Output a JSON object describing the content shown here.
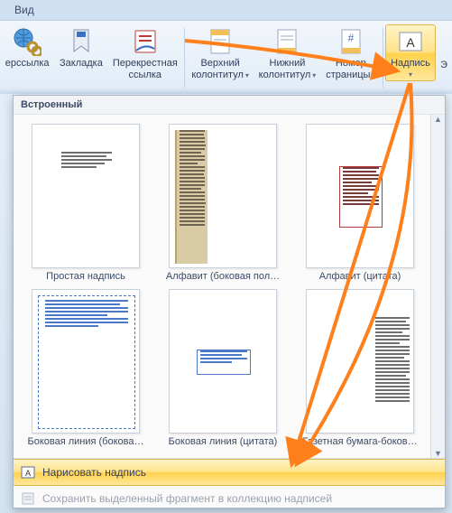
{
  "tab": {
    "label": "Вид"
  },
  "ribbon": {
    "hyperlink": "ерссылка",
    "bookmark": "Закладка",
    "crossref_l1": "Перекрестная",
    "crossref_l2": "ссылка",
    "header_l1": "Верхний",
    "header_l2": "колонтитул",
    "footer_l1": "Нижний",
    "footer_l2": "колонтитул",
    "pagenum_l1": "Номер",
    "pagenum_l2": "страницы",
    "textbox": "Надпись",
    "extra": "Э"
  },
  "panel": {
    "heading": "Встроенный",
    "items": [
      "Простая надпись",
      "Алфавит (боковая пол…",
      "Алфавит (цитата)",
      "Боковая линия (бокова…",
      "Боковая линия (цитата)",
      "Газетная бумага-боков…"
    ],
    "draw": "Нарисовать надпись",
    "save": "Сохранить выделенный фрагмент в коллекцию надписей"
  }
}
